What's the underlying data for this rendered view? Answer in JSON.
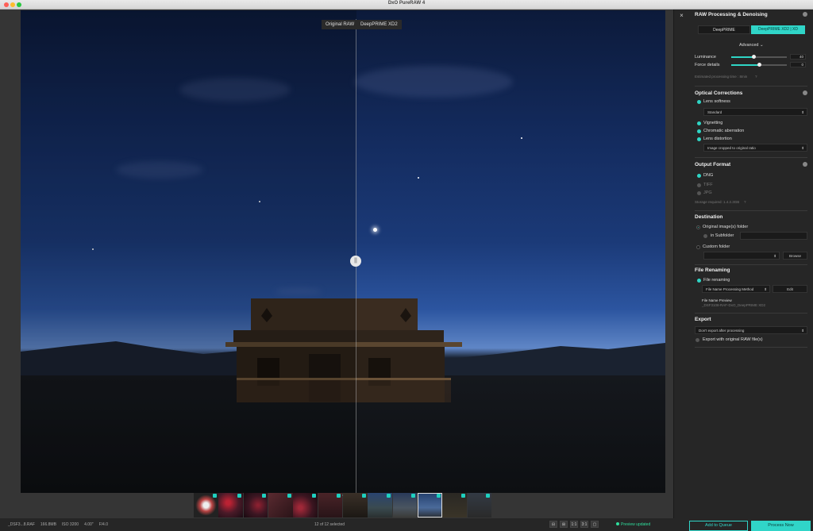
{
  "app": {
    "title": "DxO PureRAW 4"
  },
  "viewer": {
    "before_label": "Original RAW",
    "after_label": "DeepPRIME XD2",
    "split_handle": "||",
    "collapse": "⌄"
  },
  "filmstrip": {
    "count": 12,
    "selected_index": 9
  },
  "statusbar": {
    "filename": "_DSF3...8.RAF",
    "filesize": "166.8MB",
    "iso": "ISO 3200",
    "shutter": "4.00\"",
    "aperture": "F/4.0",
    "selection": "12 of 12 selected",
    "tools": [
      "⊟",
      "⊞",
      "1:1",
      "3:1",
      "▢"
    ],
    "preview_status": "Preview updated",
    "add_queue": "Add to Queue",
    "process_now": "Process Now"
  },
  "panel": {
    "close": "×",
    "raw": {
      "title": "RAW Processing & Denoising",
      "mode_a": "DeepPRIME",
      "mode_b": "DeepPRIME XD2 | XD",
      "advanced": "Advanced ⌄",
      "luminance_label": "Luminance",
      "luminance_value": "40",
      "luminance_fraction": 0.4,
      "force_label": "Force details",
      "force_value": "0",
      "force_fraction": 0.5,
      "estimate": "Estimated processing time : 8min",
      "estimate_icon": "?"
    },
    "optical": {
      "title": "Optical Corrections",
      "lens_softness": "Lens softness",
      "softness_option": "Standard",
      "vignetting": "Vignetting",
      "chromatic": "Chromatic aberration",
      "distortion": "Lens distortion",
      "distortion_option": "Image cropped to original ratio"
    },
    "output": {
      "title": "Output Format",
      "dng": "DNG",
      "tiff": "TIFF",
      "jpg": "JPG",
      "storage": "Storage required: 1.4.2.3GB",
      "storage_icon": "?"
    },
    "destination": {
      "title": "Destination",
      "original": "Original image(s) folder",
      "subfolder": "in Subfolder",
      "custom": "Custom folder",
      "browse": "Browse"
    },
    "renaming": {
      "title": "File Renaming",
      "toggle": "File renaming",
      "method": "File Name Processing Method",
      "edit": "Edit",
      "preview_label": "File Name Preview",
      "preview_value": "_DSF3108-RAF-DxO_DeepPRIME XD2"
    },
    "export": {
      "title": "Export",
      "option": "Don't export after processing",
      "with_raw": "Export with original RAW file(s)"
    }
  },
  "colors": {
    "accent": "#30d5c8",
    "status_green": "#2fdf9d"
  }
}
